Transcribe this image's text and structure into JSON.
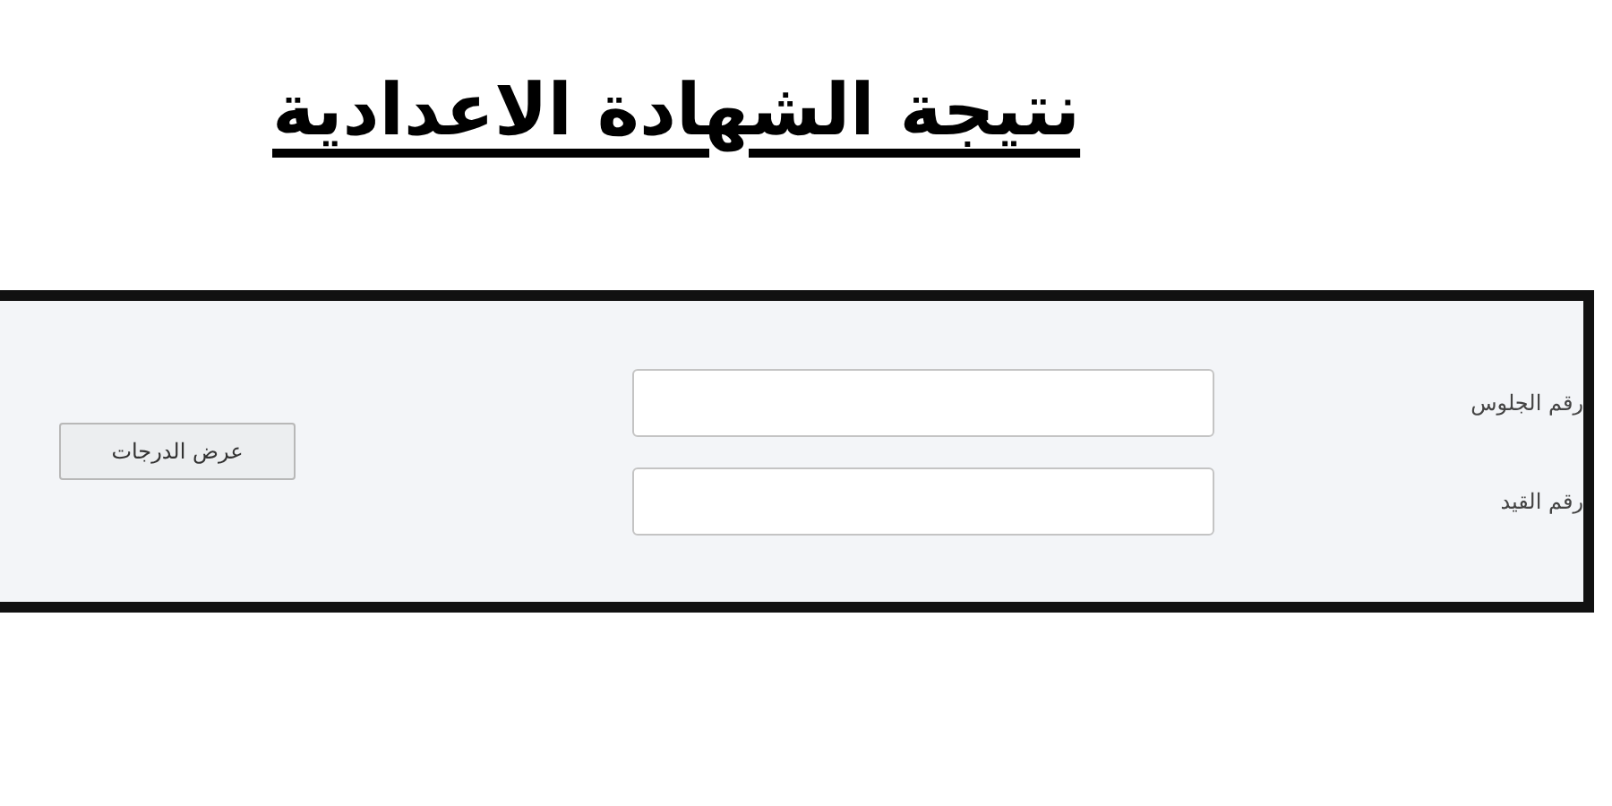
{
  "title": "نتيجة الشهادة الاعدادية",
  "form": {
    "fields": [
      {
        "label": "رقم الجلوس"
      },
      {
        "label": "رقم القيد"
      }
    ],
    "button": "عرض الدرجات"
  }
}
